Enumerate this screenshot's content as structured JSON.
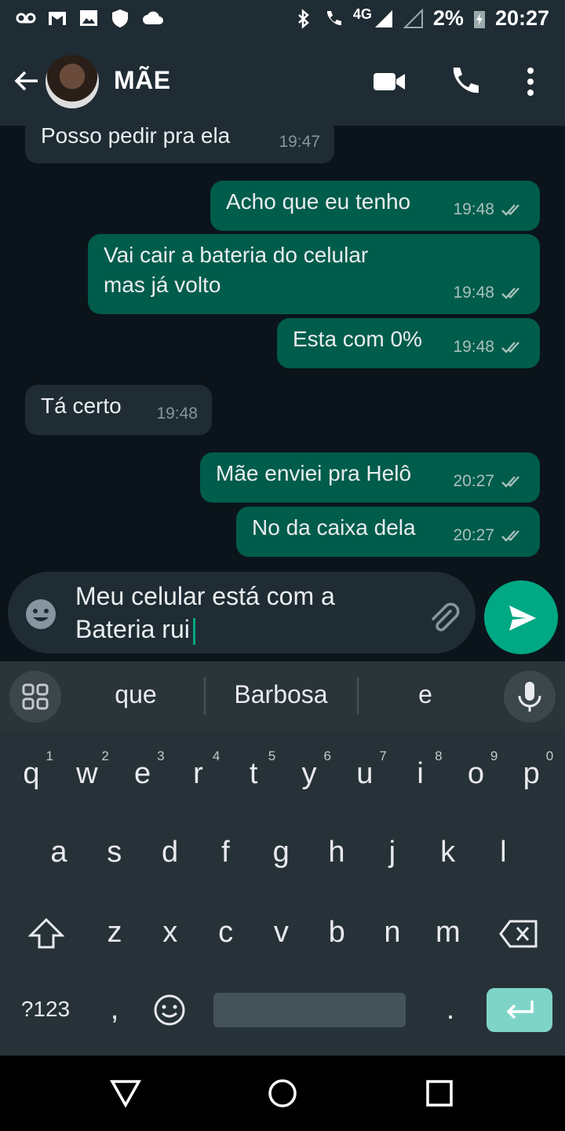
{
  "status_bar": {
    "signal_label": "4G",
    "battery": "2%",
    "time": "20:27",
    "icons": [
      "voicemail-icon",
      "gmail-icon",
      "gallery-icon",
      "shield-icon",
      "cloud-icon",
      "bluetooth-icon",
      "volte-call-icon",
      "signal-icon",
      "no-signal-icon",
      "battery-charging-icon"
    ]
  },
  "header": {
    "contact_name": "MÃE"
  },
  "messages": [
    {
      "direction": "in",
      "text": "Posso pedir pra ela",
      "time": "19:47"
    },
    {
      "direction": "out",
      "text": "Acho que eu tenho",
      "time": "19:48"
    },
    {
      "direction": "out",
      "text": "Vai cair a bateria do celular\nmas já volto",
      "time": "19:48"
    },
    {
      "direction": "out",
      "text": "Esta com 0%",
      "time": "19:48"
    },
    {
      "direction": "in",
      "text": "Tá certo",
      "time": "19:48"
    },
    {
      "direction": "out",
      "text": "Mãe enviei pra Helô",
      "time": "20:27"
    },
    {
      "direction": "out",
      "text": "No da caixa dela",
      "time": "20:27"
    }
  ],
  "compose": {
    "value": "Meu celular está com a Bateria rui"
  },
  "keyboard": {
    "suggestions": [
      "que",
      "Barbosa",
      "e"
    ],
    "row1": [
      "q",
      "w",
      "e",
      "r",
      "t",
      "y",
      "u",
      "i",
      "o",
      "p"
    ],
    "row1_hints": [
      "1",
      "2",
      "3",
      "4",
      "5",
      "6",
      "7",
      "8",
      "9",
      "0"
    ],
    "row2": [
      "a",
      "s",
      "d",
      "f",
      "g",
      "h",
      "j",
      "k",
      "l"
    ],
    "row3": [
      "z",
      "x",
      "c",
      "v",
      "b",
      "n",
      "m"
    ],
    "symbols_label": "?123",
    "comma": ",",
    "period": "."
  },
  "colors": {
    "accent": "#00a884",
    "outgoing": "#005c4b",
    "incoming": "#1f2c34",
    "header": "#1f2c34"
  }
}
